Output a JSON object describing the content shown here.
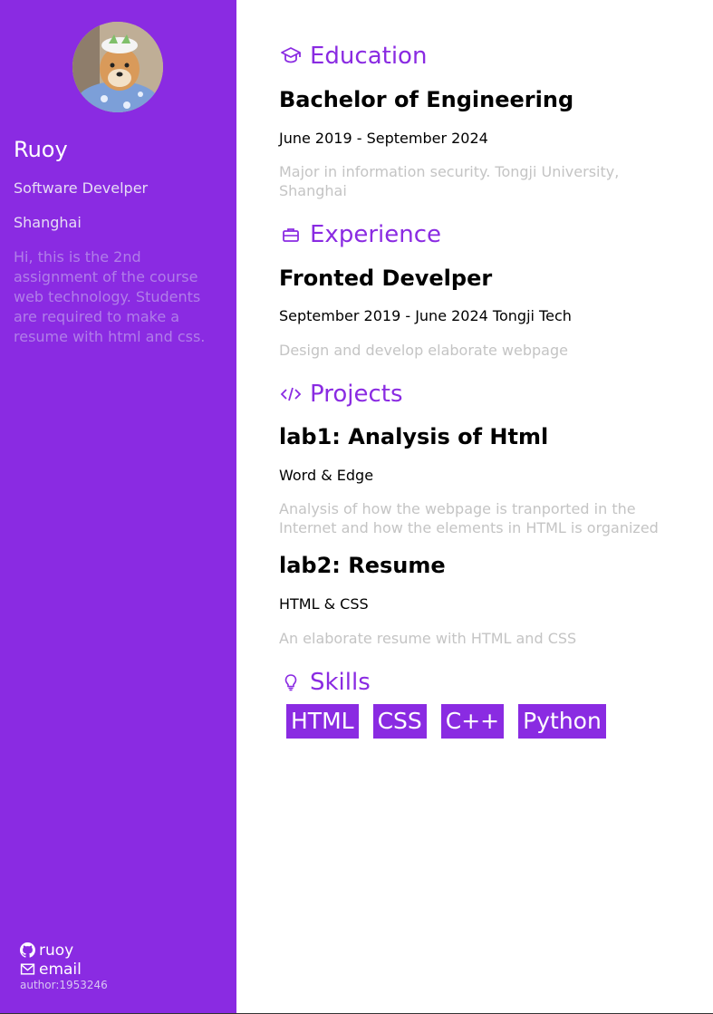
{
  "sidebar": {
    "name": "Ruoy",
    "role": "Software Develper",
    "city": "Shanghai",
    "bio": "Hi, this is the 2nd assignment of the course web technology. Students are required to make a resume with html and css.",
    "links": [
      {
        "icon": "github-icon",
        "label": "ruoy"
      },
      {
        "icon": "mail-icon",
        "label": "email"
      }
    ],
    "author": "author:1953246"
  },
  "education": {
    "heading": "Education",
    "title": "Bachelor of Engineering",
    "meta": "June 2019 - September 2024",
    "desc": "Major in information security. Tongji University, Shanghai"
  },
  "experience": {
    "heading": "Experience",
    "title": "Fronted Develper",
    "meta": "September 2019 - June 2024 Tongji Tech",
    "desc": "Design and develop elaborate webpage"
  },
  "projects": {
    "heading": "Projects",
    "items": [
      {
        "title": "lab1: Analysis of Html",
        "meta": "Word & Edge",
        "desc": "Analysis of how the webpage is tranported in the Internet and how the elements in HTML is organized"
      },
      {
        "title": "lab2: Resume",
        "meta": "HTML & CSS",
        "desc": "An elaborate resume with HTML and CSS"
      }
    ]
  },
  "skills": {
    "heading": "Skills",
    "items": [
      "HTML",
      "CSS",
      "C++",
      "Python"
    ]
  },
  "colors": {
    "accent": "#8a2be2",
    "muted_text": "#c4c4c4"
  }
}
